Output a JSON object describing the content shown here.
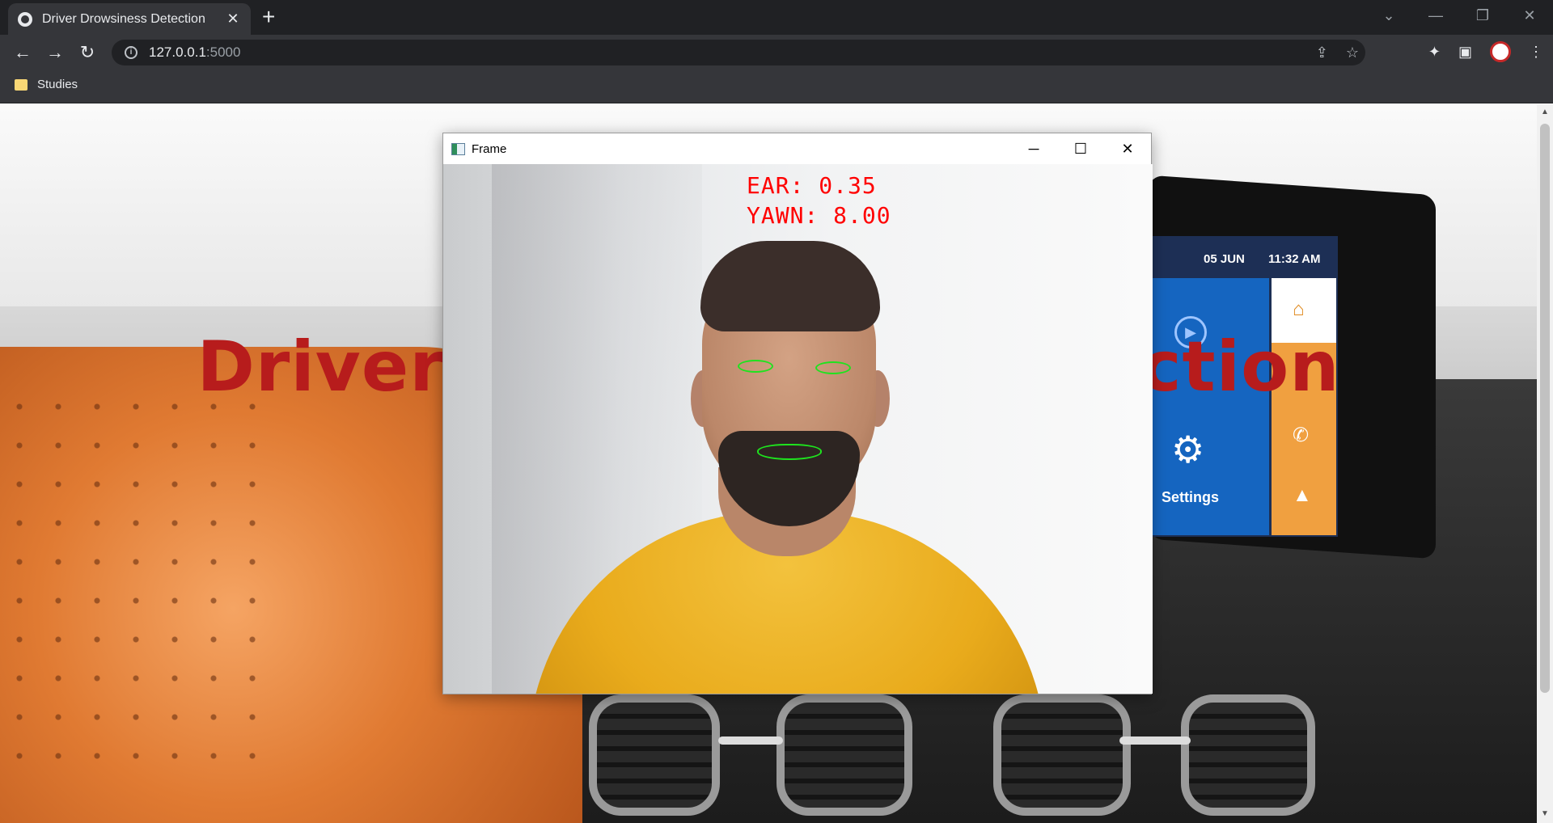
{
  "browser": {
    "tab_title": "Driver Drowsiness Detection",
    "new_tab": "+",
    "url_host": "127.0.0.1",
    "url_port": ":5000",
    "bookmark": "Studies"
  },
  "page": {
    "heading": "Driver Drowsiness Detection",
    "dashboard_date": "05 JUN",
    "dashboard_time": "11:32 AM",
    "dashboard_settings": "Settings"
  },
  "cv_window": {
    "title": "Frame",
    "ear_text": "EAR: 0.35",
    "yawn_text": "YAWN: 8.00"
  },
  "icons": {
    "back": "back-arrow-icon",
    "forward": "forward-arrow-icon",
    "reload": "reload-icon",
    "share": "share-icon",
    "bookmark_star": "star-icon",
    "extensions": "puzzle-icon",
    "side_panel": "side-panel-icon",
    "menu": "kebab-menu-icon"
  }
}
